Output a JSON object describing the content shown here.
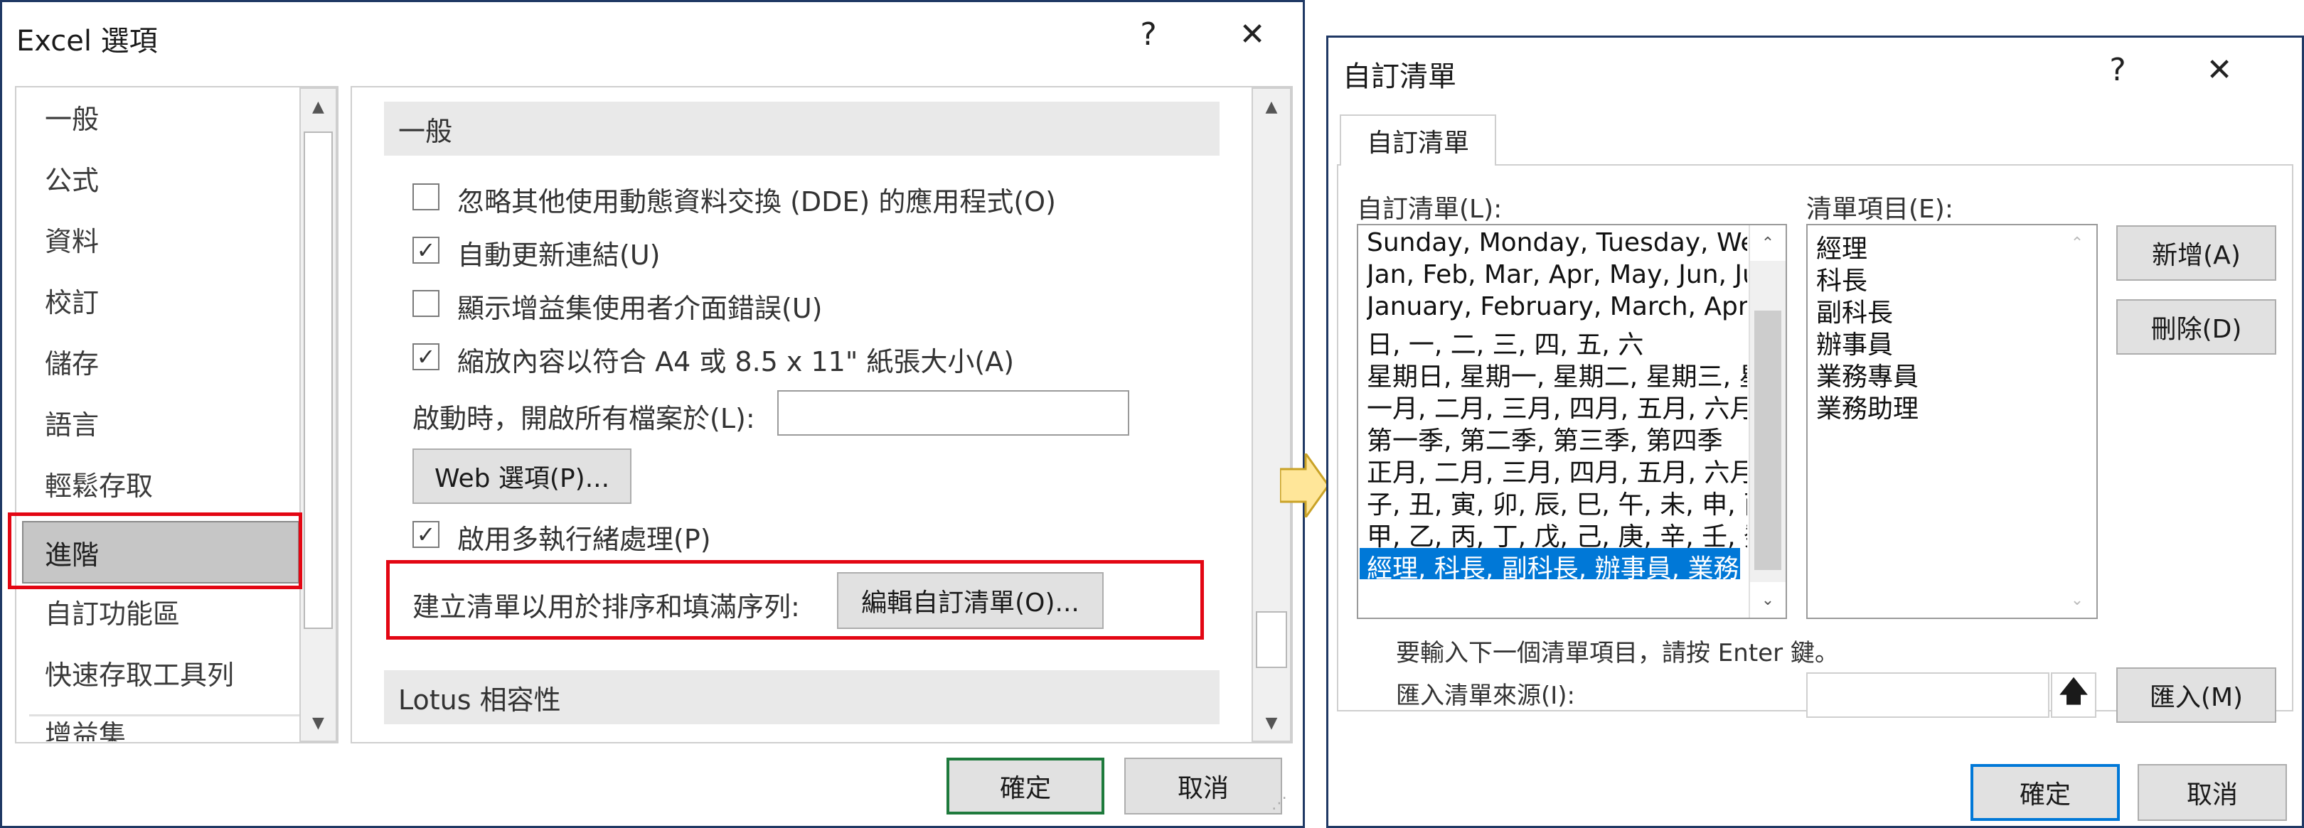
{
  "excel_options": {
    "title": "Excel 選項",
    "help": "?",
    "close": "✕",
    "nav": [
      "一般",
      "公式",
      "資料",
      "校訂",
      "儲存",
      "語言",
      "輕鬆存取",
      "進階",
      "自訂功能區",
      "快速存取工具列",
      "增益集"
    ],
    "selected_nav": "進階",
    "section_general": "一般",
    "checkboxes": [
      {
        "label": "忽略其他使用動態資料交換 (DDE) 的應用程式(O)",
        "checked": false
      },
      {
        "label": "自動更新連結(U)",
        "checked": true
      },
      {
        "label": "顯示增益集使用者介面錯誤(U)",
        "checked": false
      },
      {
        "label": "縮放內容以符合 A4 或 8.5 x 11\" 紙張大小(A)",
        "checked": true
      }
    ],
    "startup_label": "啟動時，開啟所有檔案於(L):",
    "startup_value": "",
    "web_options_btn": "Web 選項(P)...",
    "multithread_label": "啟用多執行緒處理(P)",
    "multithread_checked": true,
    "custom_list_label": "建立清單以用於排序和填滿序列:",
    "edit_custom_list_btn": "編輯自訂清單(O)...",
    "section_lotus": "Lotus 相容性",
    "ok": "確定",
    "cancel": "取消",
    "check_glyph": "✓"
  },
  "custom_lists": {
    "title": "自訂清單",
    "help": "?",
    "close": "✕",
    "tab": "自訂清單",
    "lists_label": "自訂清單(L):",
    "lists": [
      "Sunday, Monday, Tuesday, Wec",
      "Jan, Feb, Mar, Apr, May, Jun, Jul",
      "January, February, March, April,",
      "日, 一, 二, 三, 四, 五, 六",
      "星期日, 星期一, 星期二, 星期三, 星",
      "一月, 二月, 三月, 四月, 五月, 六月,",
      "第一季, 第二季, 第三季, 第四季",
      "正月, 二月, 三月, 四月, 五月, 六月,",
      "子, 丑, 寅, 卯, 辰, 巳, 午, 未, 申, 酉,",
      "甲, 乙, 丙, 丁, 戊, 己, 庚, 辛, 壬, 癸",
      "經理, 科長, 副科長, 辦事員, 業務專"
    ],
    "selected_index": 10,
    "entries_label": "清單項目(E):",
    "entries": [
      "經理",
      "科長",
      "副科長",
      "辦事員",
      "業務專員",
      "業務助理"
    ],
    "add_btn": "新增(A)",
    "delete_btn": "刪除(D)",
    "hint": "要輸入下一個清單項目，請按 Enter 鍵。",
    "import_label": "匯入清單來源(I):",
    "import_value": "",
    "import_btn": "匯入(M)",
    "ok": "確定",
    "cancel": "取消"
  },
  "colors": {
    "dialog_border": "#1f3864",
    "highlight_red": "#e30613",
    "selection_blue": "#0078d7",
    "ok_green": "#1e7a3c",
    "arrow_yellow": "#ffe699"
  }
}
